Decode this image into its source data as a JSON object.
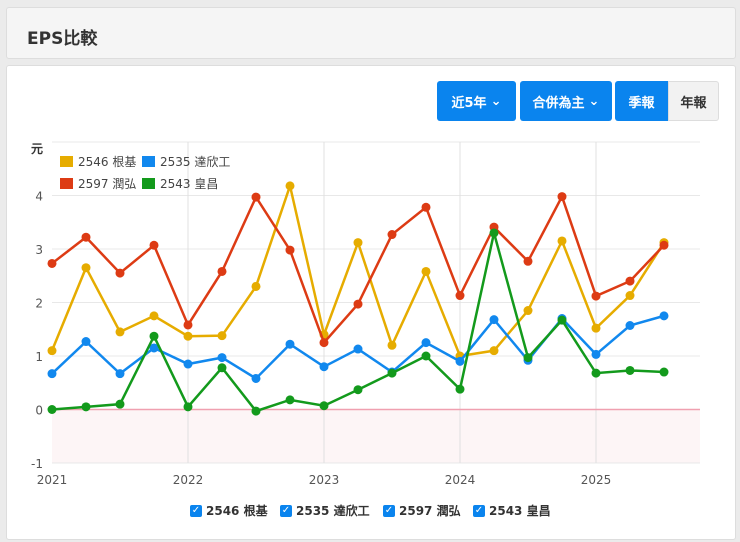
{
  "header": {
    "title": "EPS比較"
  },
  "toolbar": {
    "range": "近5年",
    "range_icon": "chevron-down-icon",
    "basis": "合併為主",
    "basis_icon": "chevron-down-icon",
    "quarterly": "季報",
    "annual": "年報"
  },
  "chart_data": {
    "type": "line",
    "ylabel": "元",
    "ylim": [
      -1,
      5
    ],
    "yticks": [
      "4",
      "3",
      "2",
      "1",
      "0",
      "-1"
    ],
    "xticks": [
      "2021",
      "2022",
      "2023",
      "2024",
      "2025"
    ],
    "x": [
      "2021Q1",
      "2021Q2",
      "2021Q3",
      "2021Q4",
      "2022Q1",
      "2022Q2",
      "2022Q3",
      "2022Q4",
      "2023Q1",
      "2023Q2",
      "2023Q3",
      "2023Q4",
      "2024Q1",
      "2024Q2",
      "2024Q3",
      "2024Q4",
      "2025Q1",
      "2025Q2",
      "2025Q3"
    ],
    "legend_placement": "top-left",
    "series": [
      {
        "name": "2546 根基",
        "color": "#e6ac00",
        "values": [
          1.1,
          2.65,
          1.45,
          1.75,
          1.37,
          1.38,
          2.3,
          4.18,
          1.4,
          3.12,
          1.2,
          2.58,
          1.0,
          1.1,
          1.85,
          3.15,
          1.52,
          2.13,
          3.12
        ]
      },
      {
        "name": "2535 達欣工",
        "color": "#1188ee",
        "values": [
          0.67,
          1.27,
          0.67,
          1.15,
          0.85,
          0.97,
          0.58,
          1.22,
          0.8,
          1.13,
          0.7,
          1.25,
          0.9,
          1.68,
          0.92,
          1.7,
          1.03,
          1.57,
          1.75
        ]
      },
      {
        "name": "2597 潤弘",
        "color": "#dd3b14",
        "values": [
          2.73,
          3.22,
          2.55,
          3.07,
          1.58,
          2.58,
          3.97,
          2.98,
          1.25,
          1.97,
          3.27,
          3.78,
          2.13,
          3.41,
          2.77,
          3.98,
          2.12,
          2.4,
          3.07
        ]
      },
      {
        "name": "2543 皇昌",
        "color": "#139a1c",
        "values": [
          0.0,
          0.05,
          0.1,
          1.37,
          0.05,
          0.78,
          -0.03,
          0.18,
          0.07,
          0.37,
          0.68,
          1.0,
          0.38,
          3.3,
          0.97,
          1.67,
          0.68,
          0.73,
          0.7
        ]
      }
    ]
  }
}
